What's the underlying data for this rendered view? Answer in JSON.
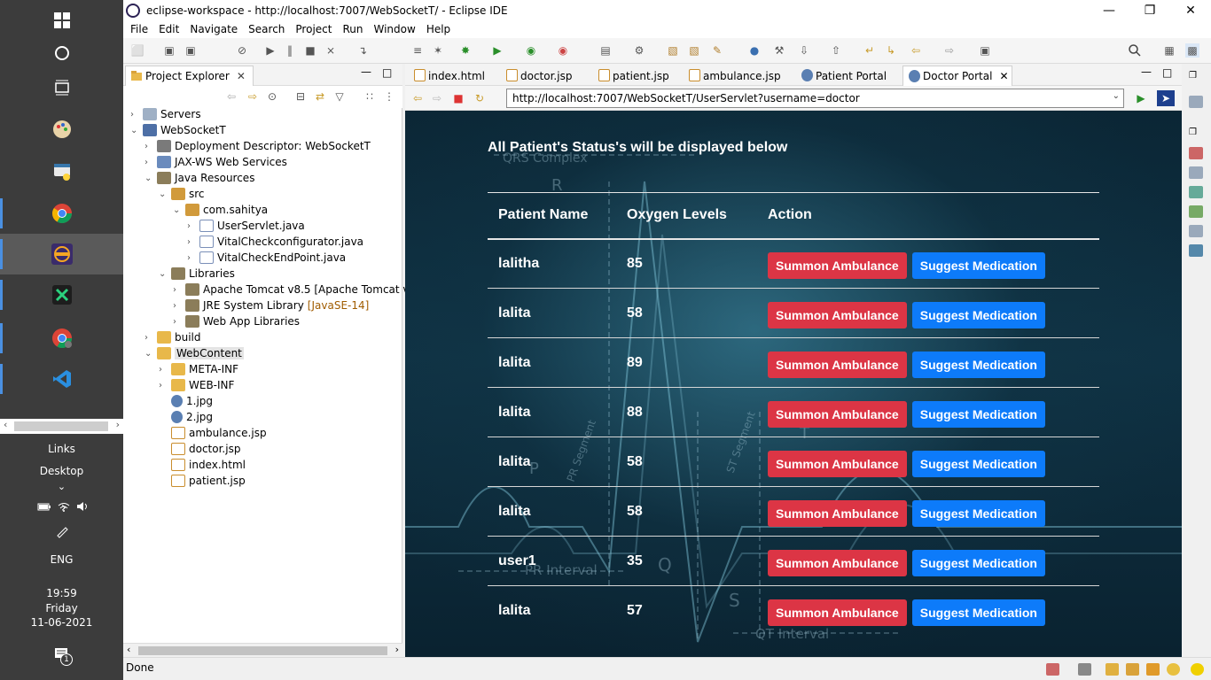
{
  "taskbar": {
    "links": "Links",
    "desktop": "Desktop",
    "language": "ENG",
    "time": "19:59",
    "day": "Friday",
    "date": "11-06-2021",
    "notification_count": "1"
  },
  "window": {
    "title": "eclipse-workspace - http://localhost:7007/WebSocketT/ - Eclipse IDE"
  },
  "menu": [
    "File",
    "Edit",
    "Navigate",
    "Search",
    "Project",
    "Run",
    "Window",
    "Help"
  ],
  "explorer": {
    "tab_label": "Project Explorer",
    "tree": [
      {
        "label": "Servers"
      },
      {
        "label": "WebSocketT"
      },
      {
        "label": "Deployment Descriptor: WebSocketT"
      },
      {
        "label": "JAX-WS Web Services"
      },
      {
        "label": "Java Resources"
      },
      {
        "label": "src"
      },
      {
        "label": "com.sahitya"
      },
      {
        "label": "UserServlet.java"
      },
      {
        "label": "VitalCheckconfigurator.java"
      },
      {
        "label": "VitalCheckEndPoint.java"
      },
      {
        "label": "Libraries"
      },
      {
        "label": "Apache Tomcat v8.5 [Apache Tomcat v8.5]"
      },
      {
        "label": "JRE System Library",
        "decoration": "[JavaSE-14]"
      },
      {
        "label": "Web App Libraries"
      },
      {
        "label": "build"
      },
      {
        "label": "WebContent"
      },
      {
        "label": "META-INF"
      },
      {
        "label": "WEB-INF"
      },
      {
        "label": "1.jpg"
      },
      {
        "label": "2.jpg"
      },
      {
        "label": "ambulance.jsp"
      },
      {
        "label": "doctor.jsp"
      },
      {
        "label": "index.html"
      },
      {
        "label": "patient.jsp"
      }
    ]
  },
  "editor": {
    "tabs": [
      {
        "label": "index.html"
      },
      {
        "label": "doctor.jsp"
      },
      {
        "label": "patient.jsp"
      },
      {
        "label": "ambulance.jsp"
      },
      {
        "label": "Patient Portal"
      },
      {
        "label": "Doctor Portal"
      }
    ],
    "url": "http://localhost:7007/WebSocketT/UserServlet?username=doctor"
  },
  "page": {
    "heading": "All Patient's Status's will be displayed below",
    "columns": [
      "Patient Name",
      "Oxygen Levels",
      "Action"
    ],
    "summon_label": "Summon Ambulance",
    "suggest_label": "Suggest Medication",
    "rows": [
      {
        "name": "lalitha",
        "oxygen": "85"
      },
      {
        "name": "lalita",
        "oxygen": "58"
      },
      {
        "name": "lalita",
        "oxygen": "89"
      },
      {
        "name": "lalita",
        "oxygen": "88"
      },
      {
        "name": "lalita",
        "oxygen": "58"
      },
      {
        "name": "lalita",
        "oxygen": "58"
      },
      {
        "name": "user1",
        "oxygen": "35"
      },
      {
        "name": "lalita",
        "oxygen": "57"
      }
    ],
    "background_text": [
      "QRS Complex",
      "R",
      "PR Segment",
      "ST Segment",
      "T",
      "P",
      "Q",
      "S",
      "PR Interval",
      "QT Interval"
    ]
  },
  "status": {
    "text": "Done"
  },
  "colors": {
    "summon": "#dc3545",
    "suggest": "#0d7bfa",
    "page_bg": "#0f3244"
  }
}
